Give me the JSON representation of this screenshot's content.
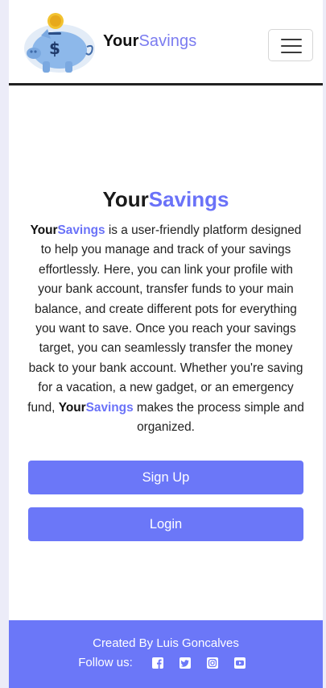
{
  "navbar": {
    "brand_part1": "Your",
    "brand_part2": "Savings",
    "logo_icon": "piggy-bank-coin-icon",
    "menu_icon": "hamburger-menu-icon"
  },
  "hero": {
    "title_part1": "Your",
    "title_part2": "Savings",
    "text_brand1": "Your",
    "text_brand2": "Savings",
    "text_body1": " is a user-friendly platform designed to help you manage and track of your savings effortlessly. Here, you can link your profile with your bank account, transfer funds to your main balance, and create different pots for everything you want to save. Once you reach your savings target, you can seamlessly transfer the money back to your bank account. Whether you're saving for a vacation, a new gadget, or an emergency fund, ",
    "text_body2": " makes the process simple and organized."
  },
  "buttons": {
    "signup_label": "Sign Up",
    "login_label": "Login"
  },
  "footer": {
    "created_by": "Created By Luis Goncalves",
    "follow_label": "Follow us:",
    "social_icons": [
      "facebook-icon",
      "twitter-icon",
      "instagram-icon",
      "youtube-icon"
    ]
  },
  "colors": {
    "accent": "#6b77f8",
    "brand_purple": "#7b7cf0",
    "background": "#ececf8"
  }
}
